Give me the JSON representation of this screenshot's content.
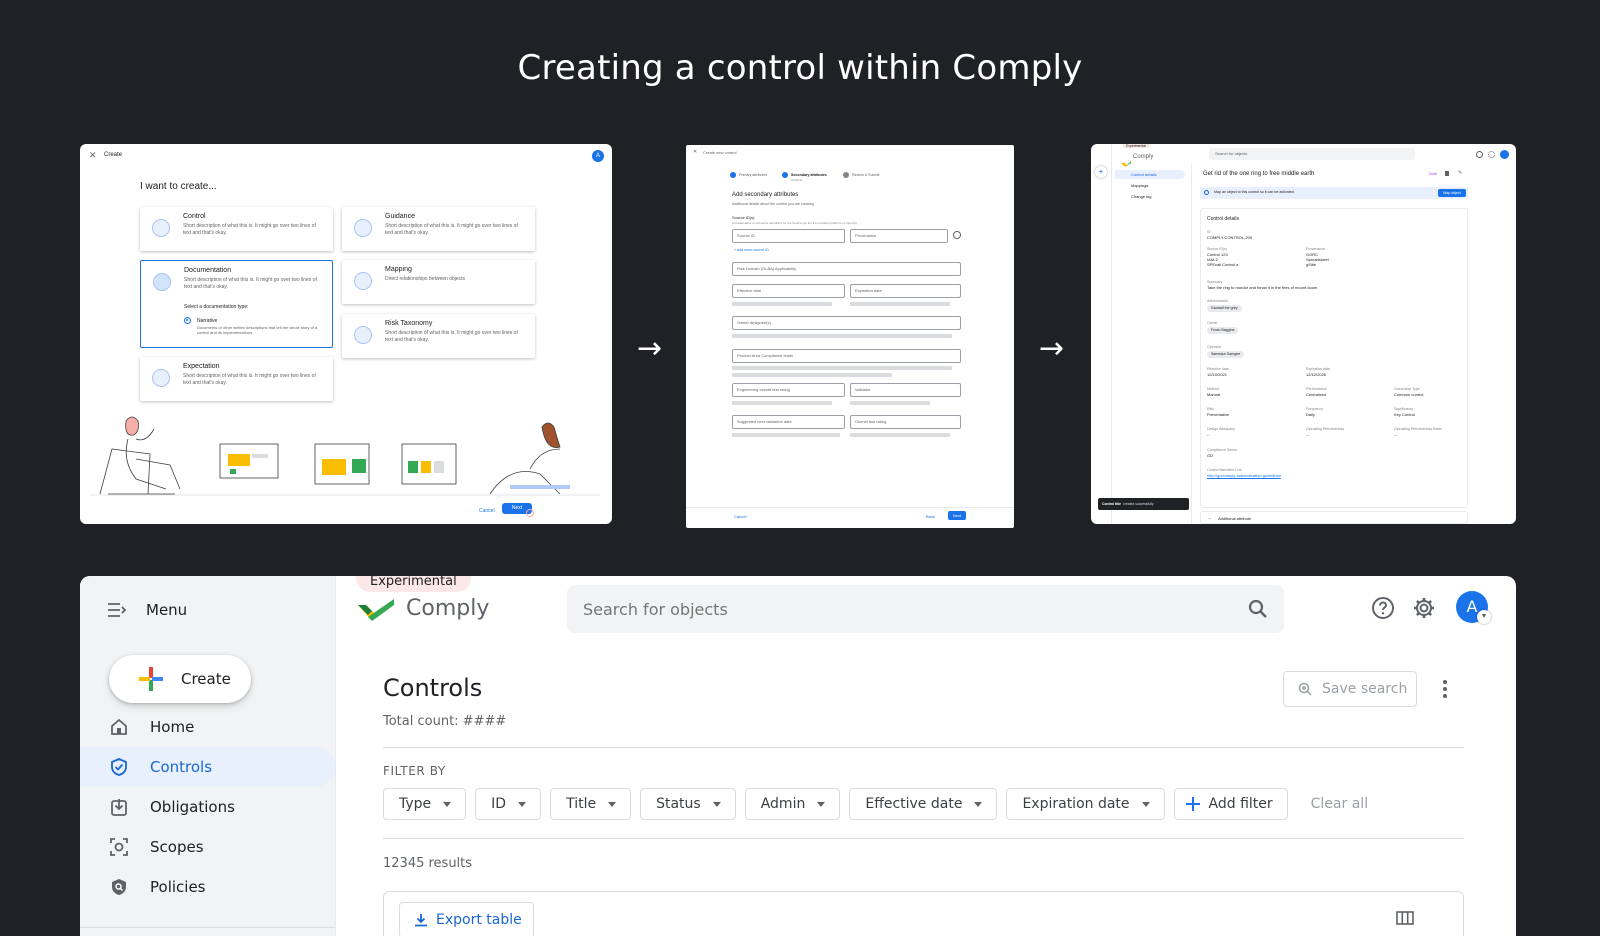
{
  "headline": "Creating a control within Comply",
  "arrow": "→",
  "panel1": {
    "title": "Create",
    "avatar": "A",
    "heading": "I want to create...",
    "cards": [
      {
        "title": "Control",
        "desc": "Short description of what this is. It might go over two lines of text and that's okay."
      },
      {
        "title": "Guidance",
        "desc": "Short description of what this is. It might go over two lines of text and that's okay."
      },
      {
        "title": "Documentation",
        "desc": "Short description of what this is. It might go over two lines of text and that's okay."
      },
      {
        "title": "Mapping",
        "desc": "Direct relationships between objects"
      },
      {
        "title": "Risk Taxonomy",
        "desc": "Short description of what this is. It might go over two lines of text and that's okay."
      },
      {
        "title": "Expectation",
        "desc": "Short description of what this is. It might go over two lines of text and that's okay."
      }
    ],
    "doc_type_label": "Select a documentation type:",
    "radio_label": "Narrative",
    "radio_desc": "Documents or other written descriptions that tell the whole story of a control and its implementations.",
    "cancel": "Cancel",
    "next": "Next"
  },
  "panel2": {
    "title": "Create new control",
    "steps": [
      "Primary attributes",
      "Secondary attributes",
      "Review & Submit"
    ],
    "step_sub": "Optional",
    "heading": "Add secondary attributes",
    "subheading": "Additional details about the control you are creating",
    "source_label": "Source ID(s)",
    "source_help": "List alternative or reference identifiers for the Source (up the from another platform or Comply).",
    "source_id": "Source ID",
    "provenance": "Provenance",
    "add_source": "+ Add more source ID",
    "fields": [
      "Risk Domain (GLBA) Applicability",
      "Effective date",
      "Expiration date",
      "Owner designee(s)",
      "Product Area Compliance leads",
      "Engineering overall test rating",
      "Validator",
      "Suggested next validation date",
      "Overall test rating"
    ],
    "cancel": "Cancel",
    "back": "Back",
    "next": "Next"
  },
  "panel3": {
    "badge": "Experimental",
    "brand": "Comply",
    "search": "Search for objects",
    "nav": [
      "Control details",
      "Mappings",
      "Change log"
    ],
    "title": "Get rid of the one ring to free middle earth",
    "edit": "Draft",
    "banner": "Map an object to this control so it can be activated",
    "map_btn": "Map object",
    "section": "Control details",
    "id_label": "ID",
    "id_value": "COMPLY-CONTROL-209",
    "src_label": "Source ID(s)",
    "src_values": [
      "Control 123",
      "IAM-2",
      "SPEcall Control a"
    ],
    "prov_label": "Provenance",
    "prov_values": [
      "GGRC",
      "Spreadsheet",
      "gSiite"
    ],
    "summary_label": "Summary",
    "summary": "Take the ring to mordor and throw it in the fires of mount doom",
    "admin_label": "Administrator",
    "admin": "Gandalf the grey",
    "owner_label": "Owner",
    "owner": "Frodo Baggins",
    "operator_label": "Operator",
    "operator": "Samwise Gamgee",
    "eff_label": "Effective date",
    "eff": "12/10/2021",
    "exp_label": "Expiration date",
    "exp": "12/12/2026",
    "method_label": "Method",
    "method": "Manual",
    "perf_label": "Performance",
    "perf": "Centralized",
    "otype_label": "Ownership Type",
    "otype": "Common control",
    "risk_label": "Risk",
    "risk": "Preventative",
    "freq_label": "Frequency",
    "freq": "Daily",
    "sig_label": "Significance",
    "sig": "Key Control",
    "di_label": "Design Adequacy",
    "di": "--",
    "oe_label": "Operating Effectiveness",
    "oe": "--",
    "oer_label": "Operating Effectiveness Basis",
    "oer": "--",
    "cs_label": "Compliance Sector",
    "cs": "GD",
    "link_label": "Control Narrative Link",
    "link": "http://go/comply-authentication-guidelines",
    "toast_bold": "Control title",
    "toast": " created successfully",
    "more": "Additional attribute"
  },
  "app": {
    "menu": "Menu",
    "create": "Create",
    "badge": "Experimental",
    "brand": "Comply",
    "search_placeholder": "Search for objects",
    "avatar": "A",
    "nav": [
      "Home",
      "Controls",
      "Obligations",
      "Scopes",
      "Policies"
    ],
    "page_title": "Controls",
    "total_count": "Total count: ####",
    "save_search": "Save search",
    "filter_by": "FILTER BY",
    "filters": [
      "Type",
      "ID",
      "Title",
      "Status",
      "Admin",
      "Effective date",
      "Expiration date"
    ],
    "add_filter": "Add filter",
    "clear_all": "Clear all",
    "results": "12345 results",
    "export": "Export table"
  },
  "colors": {
    "background": "#202124",
    "accent": "#1a73e8",
    "nav_active_bg": "#e8f0fe",
    "badge_bg": "#fce8e6"
  }
}
